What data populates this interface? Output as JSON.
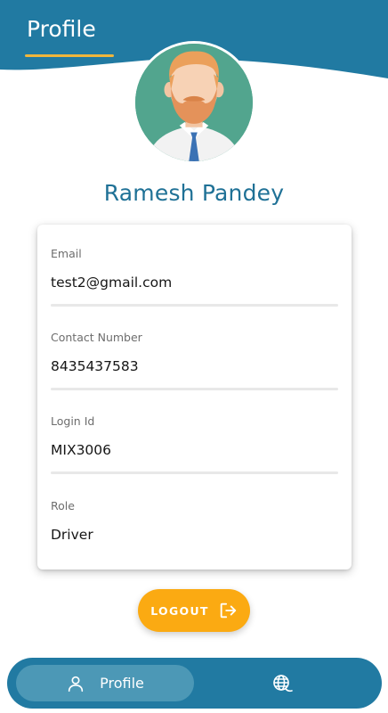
{
  "header": {
    "title": "Profile",
    "background_color": "#217aa2",
    "underline_color": "#f0b63c"
  },
  "profile": {
    "avatar_icon": "bearded-man-avatar",
    "name": "Ramesh Pandey"
  },
  "fields": [
    {
      "label": "Email",
      "value": "test2@gmail.com"
    },
    {
      "label": "Contact Number",
      "value": "8435437583"
    },
    {
      "label": "Login Id",
      "value": "MIX3006"
    },
    {
      "label": "Role",
      "value": "Driver"
    }
  ],
  "actions": {
    "logout_label": "LOGOUT",
    "logout_icon": "logout-icon",
    "logout_color": "#fbaa12"
  },
  "bottom_nav": {
    "items": [
      {
        "label": "Profile",
        "icon": "user-icon",
        "active": true
      },
      {
        "label": "",
        "icon": "globe-icon",
        "active": false
      }
    ]
  }
}
